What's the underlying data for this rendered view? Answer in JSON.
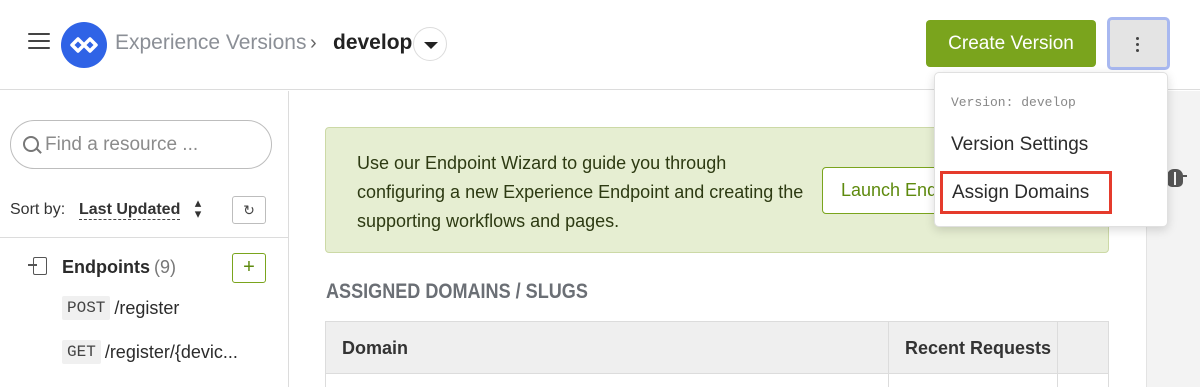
{
  "header": {
    "breadcrumb_root": "Experience Versions",
    "breadcrumb_separator": "›",
    "breadcrumb_current": "develop",
    "create_button": "Create Version"
  },
  "menu": {
    "version_label": "Version: develop",
    "items": [
      {
        "label": "Version Settings"
      },
      {
        "label": "Assign Domains"
      }
    ]
  },
  "sidebar": {
    "search_placeholder": "Find a resource ...",
    "sort_label": "Sort by:",
    "sort_value": "Last Updated",
    "endpoints": {
      "title": "Endpoints",
      "count": "(9)",
      "add_label": "+",
      "items": [
        {
          "method": "POST",
          "path": "/register"
        },
        {
          "method": "GET",
          "path": "/register/{devic..."
        }
      ]
    }
  },
  "main": {
    "banner_text": "Use our Endpoint Wizard to guide you through configuring a new Experience Endpoint and creating the supporting workflows and pages.",
    "launch_button": "Launch Endpoint Wizard",
    "section_title": "ASSIGNED DOMAINS / SLUGS",
    "table": {
      "columns": [
        "Domain",
        "Recent Requests"
      ]
    }
  },
  "colors": {
    "accent_green": "#7aa41d",
    "brand_blue": "#2f63e6",
    "highlight_red": "#e53b2c"
  },
  "icons": [
    "hamburger-icon",
    "logo-icon",
    "chevron-down-icon",
    "more-vertical-icon",
    "search-icon",
    "sort-caret-icon",
    "refresh-icon",
    "endpoint-icon",
    "plus-icon",
    "bug-icon"
  ]
}
